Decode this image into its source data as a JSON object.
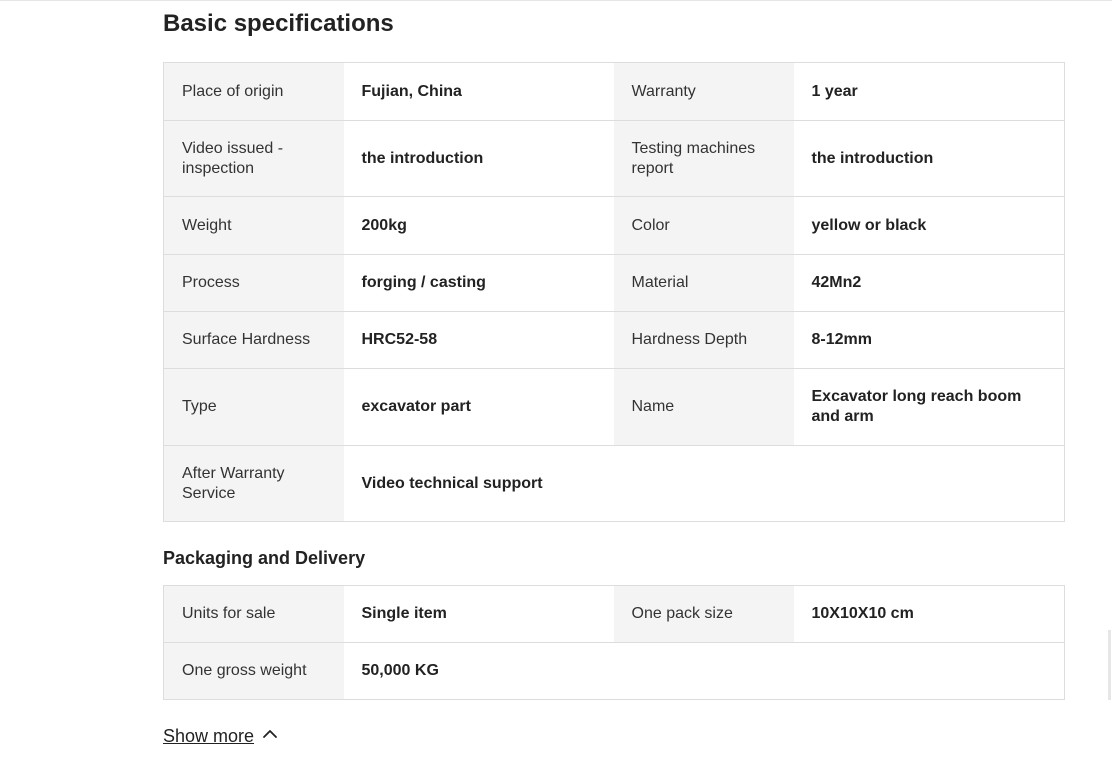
{
  "basic": {
    "title": "Basic specifications",
    "rows": [
      [
        "Place of origin",
        "Fujian, China",
        "Warranty",
        "1 year"
      ],
      [
        "Video issued - inspection",
        "the introduction",
        "Testing machines report",
        "the introduction"
      ],
      [
        "Weight",
        "200kg",
        "Color",
        "yellow or black"
      ],
      [
        "Process",
        "forging / casting",
        "Material",
        "42Mn2"
      ],
      [
        "Surface Hardness",
        "HRC52-58",
        "Hardness Depth",
        "8-12mm"
      ],
      [
        "Type",
        "excavator part",
        "Name",
        "Excavator long reach boom and arm"
      ],
      [
        "After Warranty Service",
        "Video technical support",
        "",
        ""
      ]
    ]
  },
  "packaging": {
    "title": "Packaging and Delivery",
    "rows": [
      [
        "Units for sale",
        "Single item",
        "One pack size",
        "10X10X10 cm"
      ],
      [
        "One gross weight",
        "50,000 KG",
        "",
        ""
      ]
    ]
  },
  "show_more": {
    "label": "Show more",
    "icon": "chevron-up-icon"
  }
}
